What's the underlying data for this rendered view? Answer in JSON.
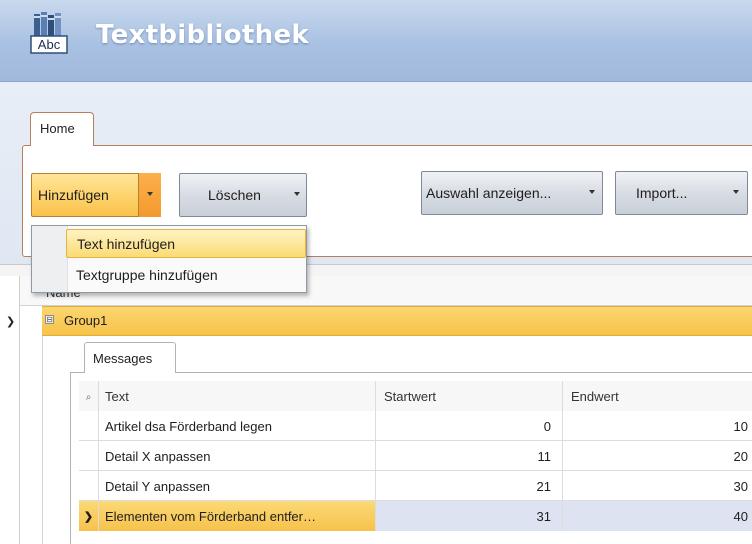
{
  "app": {
    "title": "Textbibliothek",
    "icon_label": "Abc"
  },
  "ribbon": {
    "tabs": [
      {
        "label": "Home",
        "selected": true
      }
    ],
    "buttons": {
      "add": "Hinzufügen",
      "delete": "Löschen",
      "show_selection": "Auswahl anzeigen...",
      "import": "Import..."
    }
  },
  "add_menu": {
    "items": [
      {
        "label": "Text hinzufügen",
        "highlighted": true
      },
      {
        "label": "Textgruppe hinzufügen",
        "highlighted": false
      }
    ]
  },
  "grid": {
    "header": "Name",
    "group": {
      "label": "Group1",
      "expander": "⊟"
    },
    "detail_tab": "Messages",
    "columns": [
      "Text",
      "Startwert",
      "Endwert"
    ],
    "rows": [
      {
        "text": "Artikel dsa Förderband legen",
        "start": "0",
        "end": "10"
      },
      {
        "text": "Detail X anpassen",
        "start": "11",
        "end": "20"
      },
      {
        "text": "Detail Y anpassen",
        "start": "21",
        "end": "30"
      },
      {
        "text": "Elementen vom Förderband entfer…",
        "start": "31",
        "end": "40",
        "selected": true
      }
    ]
  },
  "colors": {
    "title_bar": "#a9c1e2",
    "accent_orange": "#f7c34a",
    "selection_blue": "#dde3f1"
  },
  "icons": [
    "app-book-icon",
    "dropdown-arrow-icon",
    "row-indicator-icon",
    "collapse-icon",
    "search-filter-icon"
  ]
}
